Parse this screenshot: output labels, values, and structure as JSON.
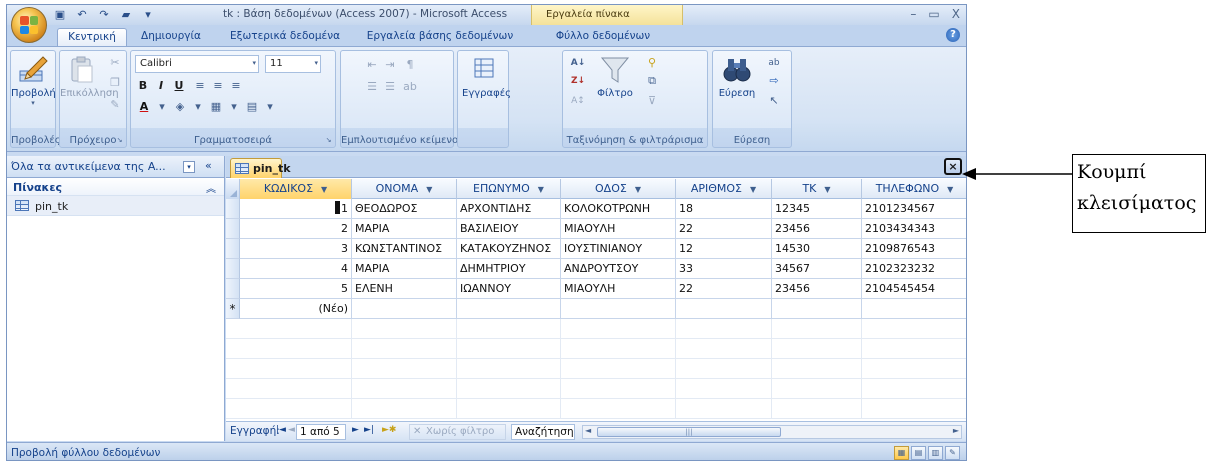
{
  "window": {
    "title": "tk : Βάση δεδομένων (Access 2007) - Microsoft Access",
    "context_tab_header": "Εργαλεία πίνακα",
    "controls": [
      "–",
      "▭",
      "X"
    ]
  },
  "ribbon": {
    "tabs": [
      {
        "label": "Κεντρική",
        "active": true
      },
      {
        "label": "Δημιουργία",
        "active": false
      },
      {
        "label": "Εξωτερικά δεδομένα",
        "active": false
      },
      {
        "label": "Εργαλεία βάσης δεδομένων",
        "active": false
      },
      {
        "label": "Φύλλο δεδομένων",
        "active": false
      }
    ],
    "groups": {
      "views": {
        "label": "Προβολές",
        "button": "Προβολή"
      },
      "clipboard": {
        "label": "Πρόχειρο",
        "button": "Επικόλληση"
      },
      "font": {
        "label": "Γραμματοσειρά",
        "font_name": "Calibri",
        "font_size": "11",
        "bold": "B",
        "italic": "I",
        "underline": "U"
      },
      "rich_text": {
        "label": "Εμπλουτισμένο κείμενο"
      },
      "records": {
        "label": "",
        "button": "Εγγραφές"
      },
      "sort_filter": {
        "label": "Ταξινόμηση & φιλτράρισμα",
        "button": "Φίλτρο"
      },
      "find": {
        "label": "Εύρεση",
        "button": "Εύρεση"
      }
    }
  },
  "nav_pane": {
    "header": "Όλα τα αντικείμενα της A...",
    "collapse": "«",
    "group": "Πίνακες",
    "items": [
      "pin_tk"
    ]
  },
  "document": {
    "tab": "pin_tk",
    "close": "×",
    "columns": [
      "ΚΩΔΙΚΟΣ",
      "ΟΝΟΜΑ",
      "ΕΠΩΝΥΜΟ",
      "ΟΔΟΣ",
      "ΑΡΙΘΜΟΣ",
      "ΤΚ",
      "ΤΗΛΕΦΩΝΟ"
    ],
    "rows": [
      [
        "1",
        "ΘΕΟΔΩΡΟΣ",
        "ΑΡΧΟΝΤΙΔΗΣ",
        "ΚΟΛΟΚΟΤΡΩΝΗ",
        "18",
        "12345",
        "2101234567"
      ],
      [
        "2",
        "ΜΑΡΙΑ",
        "ΒΑΣΙΛΕΙΟΥ",
        "ΜΙΑΟΥΛΗ",
        "22",
        "23456",
        "2103434343"
      ],
      [
        "3",
        "ΚΩΝΣΤΑΝΤΙΝΟΣ",
        "ΚΑΤΑΚΟΥΖΗΝΟΣ",
        "ΙΟΥΣΤΙΝΙΑΝΟΥ",
        "12",
        "14530",
        "2109876543"
      ],
      [
        "4",
        "ΜΑΡΙΑ",
        "ΔΗΜΗΤΡΙΟΥ",
        "ΑΝΔΡΟΥΤΣΟΥ",
        "33",
        "34567",
        "2102323232"
      ],
      [
        "5",
        "ΕΛΕΝΗ",
        "ΙΩΑΝΝΟΥ",
        "ΜΙΑΟΥΛΗ",
        "22",
        "23456",
        "2104545454"
      ]
    ],
    "new_row_marker": "*",
    "new_row_label": "(Νέο)"
  },
  "record_nav": {
    "label": "Εγγραφή:",
    "current": "1 από 5",
    "filter": "Χωρίς φίλτρο",
    "search": "Αναζήτηση"
  },
  "status": {
    "text": "Προβολή φύλλου δεδομένων"
  },
  "annotation": {
    "line1": "Κουμπί",
    "line2": "κλεισίματος"
  },
  "colors": {
    "ribbon_bg": "#d5e3f4",
    "accent_tab": "#ffd36b",
    "frame_border": "#7a96c2"
  }
}
